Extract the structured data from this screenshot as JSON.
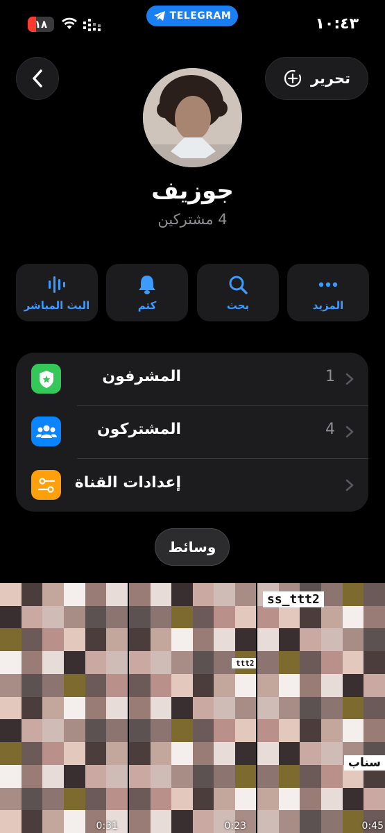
{
  "status": {
    "battery": "١٨",
    "app_pill": "TELEGRAM",
    "time": "١٠:٤٣"
  },
  "header": {
    "edit_label": "تحرير"
  },
  "channel": {
    "name": "جوزيف",
    "subscribers": "4 مشتركين"
  },
  "actions": [
    {
      "label": "المزيد",
      "icon": "more-icon"
    },
    {
      "label": "بحث",
      "icon": "search-icon"
    },
    {
      "label": "كتم",
      "icon": "bell-icon"
    },
    {
      "label": "البث المباشر",
      "icon": "live-stream-icon"
    }
  ],
  "settings": [
    {
      "label": "المشرفون",
      "count": "1",
      "icon": "admin-shield-icon",
      "color": "#34c759"
    },
    {
      "label": "المشتركون",
      "count": "4",
      "icon": "subscribers-icon",
      "color": "#0a84ff"
    },
    {
      "label": "إعدادات القناة",
      "count": "",
      "icon": "channel-settings-icon",
      "color": "#ff9f0a"
    }
  ],
  "media": {
    "tab_label": "وسائط",
    "items": [
      {
        "duration": "0:31",
        "tag": ""
      },
      {
        "duration": "0:23",
        "tag": "ttt2"
      },
      {
        "duration": "0:45",
        "tag": "ss_ttt2",
        "caption": "سناب"
      }
    ]
  }
}
